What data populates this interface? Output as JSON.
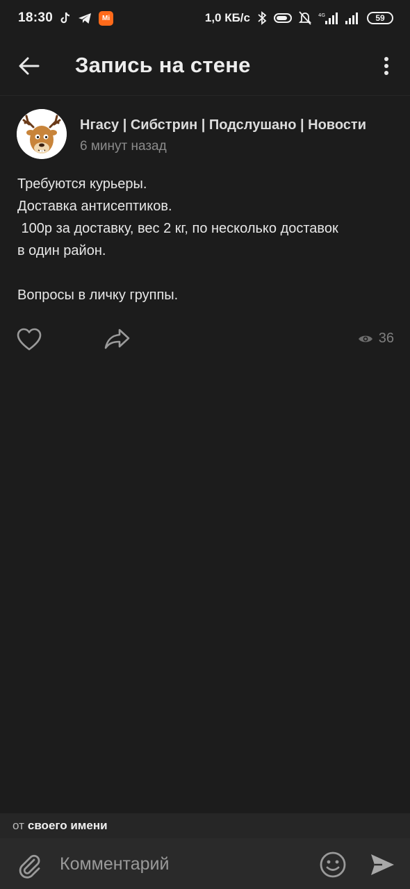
{
  "status_bar": {
    "time": "18:30",
    "net_speed": "1,0 КБ/с",
    "battery": "59",
    "mi_app_label": "Mi",
    "icons": [
      "tiktok-icon",
      "telegram-icon",
      "mi-app-icon",
      "bluetooth-icon",
      "vpn-pill-icon",
      "mute-bell-icon",
      "signal-4g-icon",
      "signal-icon",
      "battery-icon"
    ]
  },
  "header": {
    "title": "Запись на стене",
    "back_icon": "arrow-left-icon",
    "menu_icon": "more-vertical-icon"
  },
  "post": {
    "author": "Нгасу | Сибстрин | Подслушано | Новости",
    "time": "6 минут назад",
    "lines": [
      "Требуются курьеры.",
      "Доставка антисептиков.",
      " 100р за доставку, вес 2 кг, по несколько доставок",
      "в один район.",
      "",
      "Вопросы в личку группы."
    ],
    "views": "36"
  },
  "composer": {
    "as_prefix": "от",
    "as_value": "своего имени",
    "placeholder": "Комментарий"
  },
  "colors": {
    "background": "#1c1c1c",
    "composer": "#2a2a2a",
    "muted": "#8b8b8b"
  }
}
